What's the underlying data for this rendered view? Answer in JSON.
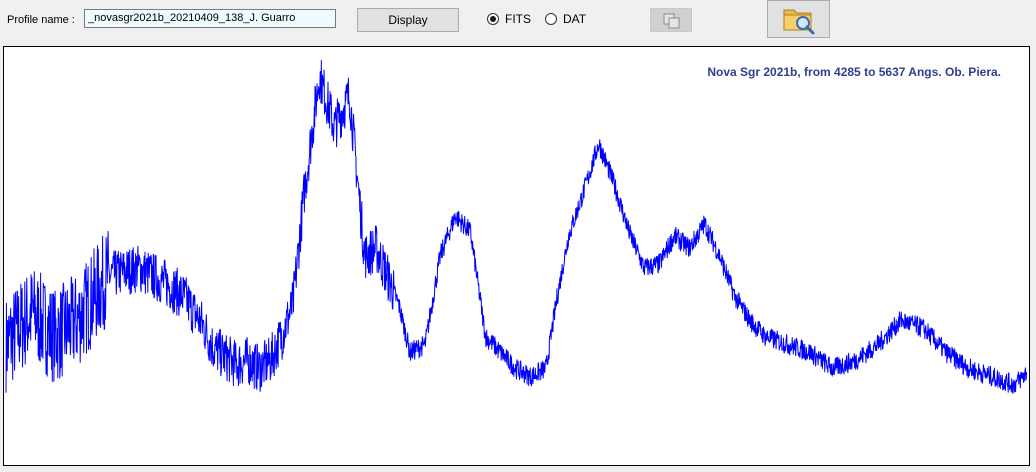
{
  "toolbar": {
    "profile_label": "Profile name :",
    "profile_value": "_novasgr2021b_20210409_138_J. Guarro",
    "display_label": "Display",
    "format_options": [
      {
        "label": "FITS",
        "selected": true
      },
      {
        "label": "DAT",
        "selected": false
      }
    ],
    "copy_icon": "copy-icon",
    "open_icon": "folder-search-icon"
  },
  "chart_data": {
    "type": "line",
    "title": "Nova Sgr 2021b, from  4285 to 5637 Angs. Ob. Piera.",
    "xlim": [
      4285,
      5637
    ],
    "series": [
      {
        "color": "#0000ff",
        "x": [
          4285,
          4320,
          4350,
          4380,
          4420,
          4460,
          4490,
          4520,
          4545,
          4560,
          4575,
          4590,
          4605,
          4620,
          4635,
          4650,
          4665,
          4680,
          4700,
          4720,
          4740,
          4760,
          4775,
          4790,
          4805,
          4820,
          4840,
          4860,
          4880,
          4900,
          4920,
          4940,
          4960,
          4980,
          5000,
          5015,
          5030,
          5050,
          5070,
          5090,
          5110,
          5130,
          5150,
          5170,
          5190,
          5210,
          5230,
          5250,
          5270,
          5290,
          5320,
          5350,
          5380,
          5410,
          5440,
          5470,
          5500,
          5530,
          5560,
          5590,
          5620,
          5637
        ],
        "y": [
          0.28,
          0.36,
          0.3,
          0.34,
          0.45,
          0.47,
          0.44,
          0.4,
          0.33,
          0.27,
          0.25,
          0.23,
          0.24,
          0.22,
          0.24,
          0.3,
          0.38,
          0.66,
          0.95,
          0.82,
          0.9,
          0.5,
          0.52,
          0.45,
          0.38,
          0.26,
          0.28,
          0.5,
          0.6,
          0.56,
          0.3,
          0.26,
          0.22,
          0.2,
          0.22,
          0.4,
          0.55,
          0.66,
          0.78,
          0.68,
          0.56,
          0.47,
          0.48,
          0.55,
          0.52,
          0.58,
          0.5,
          0.4,
          0.34,
          0.3,
          0.28,
          0.26,
          0.22,
          0.24,
          0.28,
          0.34,
          0.32,
          0.26,
          0.22,
          0.2,
          0.18,
          0.21
        ]
      }
    ],
    "grid": false,
    "ylim": [
      0,
      1
    ]
  }
}
